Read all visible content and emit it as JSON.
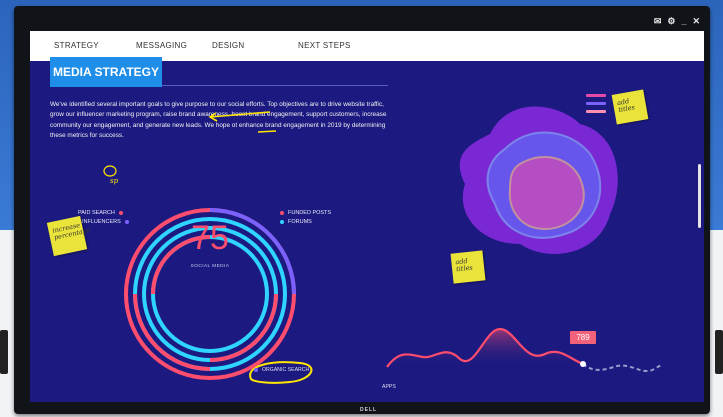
{
  "window": {
    "controls": [
      "✉",
      "⚙",
      "_",
      "✕"
    ]
  },
  "nav": {
    "tabs": [
      "STRATEGY",
      "MESSAGING",
      "DESIGN",
      "NEXT STEPS"
    ]
  },
  "slide": {
    "title": "MEDIA STRATEGY",
    "paragraph": "We've identified several important goals to give purpose to our social efforts. Top objectives are to drive website traffic, grow our influencer marketing program, raise brand awareness, boost brand engagement, support customers, increase community our engagement, and generate new leads. We hope ot enhance brand engagement in 2019 by determining these metrics for success.",
    "annotation_sp": "sp",
    "legend_left": [
      {
        "label": "PAID SEARCH",
        "color": "#ff4d6d"
      },
      {
        "label": "INFLUENCERS",
        "color": "#7a62ff"
      }
    ],
    "legend_right": [
      {
        "label": "FUNDED POSTS",
        "color": "#ff4d6d"
      },
      {
        "label": "FORUMS",
        "color": "#2fd5ff"
      }
    ],
    "ring_value": "75",
    "ring_label": "SOCIAL MEDIA",
    "organic_label": "ORGANIC SEARCH",
    "apps_label": "APPS",
    "spark_value": "789",
    "notes": {
      "add_titles_top": "add titles",
      "add_titles_mid": "add titles",
      "left_note": "increase percentage"
    }
  },
  "colors": {
    "slide_bg": "#1c1a80",
    "accent_blue": "#1f8ee8",
    "pink": "#ff4d6d",
    "cyan": "#2fd5ff",
    "purple": "#7a62ff",
    "sticky": "#e9e33a",
    "ink_yellow": "#ffe600"
  }
}
